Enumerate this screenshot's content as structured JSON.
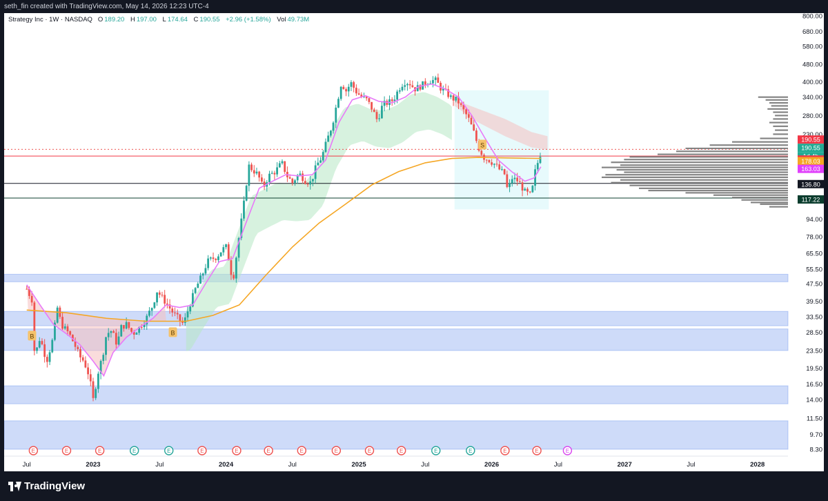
{
  "header": {
    "attribution": "seth_fin created with TradingView.com, May 14, 2026 12:23 UTC-4"
  },
  "legend": {
    "symbol": "Strategy Inc · 1W · NASDAQ",
    "open_label": "O",
    "open": "189.20",
    "high_label": "H",
    "high": "197.00",
    "low_label": "L",
    "low": "174.64",
    "close_label": "C",
    "close": "190.55",
    "change": "+2.96 (+1.58%)",
    "vol_label": "Vol",
    "vol": "49.73M"
  },
  "footer": {
    "brand": "TradingView"
  },
  "colors": {
    "up": "#26a69a",
    "down": "#ef5350",
    "ma_orange": "#f5a623",
    "ma_pink": "#e879f9",
    "zone": "#4f7fe8",
    "cloud_green": "#b6e8c5",
    "cloud_red": "#f5c0c0"
  },
  "chart_data": {
    "type": "candlestick",
    "symbol": "Strategy Inc",
    "interval": "1W",
    "exchange": "NASDAQ",
    "scale": "log",
    "ylim": [
      8.3,
      800
    ],
    "y_ticks": [
      "800.00",
      "680.00",
      "580.00",
      "480.00",
      "400.00",
      "340.00",
      "280.00",
      "230.00",
      "94.00",
      "78.00",
      "65.50",
      "55.50",
      "47.50",
      "39.50",
      "33.50",
      "28.50",
      "23.50",
      "19.50",
      "16.50",
      "14.00",
      "11.50",
      "9.70",
      "8.30"
    ],
    "x_ticks": [
      "Jul",
      "2023",
      "Jul",
      "2024",
      "Jul",
      "2025",
      "Jul",
      "2026",
      "Jul",
      "2027",
      "Jul",
      "2028"
    ],
    "price_labels": [
      {
        "value": 190.55,
        "text": "190.55",
        "color": "#f23645"
      },
      {
        "value": 190.55,
        "text": "190.55",
        "color": "#22ab94"
      },
      {
        "value": 190.55,
        "text": "1d 4h",
        "color": "#22ab94"
      },
      {
        "value": 182.47,
        "text": "182.47",
        "color": "#f23645"
      },
      {
        "value": 178.03,
        "text": "178.03",
        "color": "#f5a623"
      },
      {
        "value": 163.03,
        "text": "163.03",
        "color": "#e040fb"
      },
      {
        "value": 136.8,
        "text": "136.80",
        "color": "#131722"
      },
      {
        "value": 117.22,
        "text": "117.22",
        "color": "#0b3d2e"
      }
    ],
    "horizontal_lines": [
      {
        "value": 182.47,
        "color": "#f23645"
      },
      {
        "value": 136.8,
        "color": "#131722"
      },
      {
        "value": 117.22,
        "color": "#0b3d2e"
      }
    ],
    "zones": [
      {
        "low": 48.5,
        "high": 52.5
      },
      {
        "low": 30.5,
        "high": 35.5
      },
      {
        "low": 23.5,
        "high": 29.5
      },
      {
        "low": 13.4,
        "high": 16.2
      },
      {
        "low": 8.3,
        "high": 11.2
      }
    ],
    "signals": [
      {
        "text": "B",
        "x": 2022.54,
        "y": 27.5
      },
      {
        "text": "B",
        "x": 2023.6,
        "y": 28.5
      },
      {
        "text": "S",
        "x": 2025.93,
        "y": 206
      }
    ],
    "earnings_markers": [
      {
        "text": "E",
        "x": 2022.55,
        "type": "red"
      },
      {
        "text": "E",
        "x": 2022.8,
        "type": "red"
      },
      {
        "text": "E",
        "x": 2023.05,
        "type": "red"
      },
      {
        "text": "E",
        "x": 2023.31,
        "type": "green"
      },
      {
        "text": "E",
        "x": 2023.57,
        "type": "green"
      },
      {
        "text": "E",
        "x": 2023.82,
        "type": "red"
      },
      {
        "text": "E",
        "x": 2024.08,
        "type": "red"
      },
      {
        "text": "E",
        "x": 2024.32,
        "type": "red"
      },
      {
        "text": "E",
        "x": 2024.57,
        "type": "red"
      },
      {
        "text": "E",
        "x": 2024.83,
        "type": "red"
      },
      {
        "text": "E",
        "x": 2025.08,
        "type": "red"
      },
      {
        "text": "E",
        "x": 2025.32,
        "type": "red"
      },
      {
        "text": "E",
        "x": 2025.58,
        "type": "green"
      },
      {
        "text": "E",
        "x": 2025.84,
        "type": "green"
      },
      {
        "text": "E",
        "x": 2026.1,
        "type": "red"
      },
      {
        "text": "E",
        "x": 2026.34,
        "type": "red"
      },
      {
        "text": "E",
        "x": 2026.57,
        "type": "purple"
      }
    ],
    "price_path": [
      [
        2022.5,
        45
      ],
      [
        2022.54,
        40
      ],
      [
        2022.56,
        22
      ],
      [
        2022.6,
        27
      ],
      [
        2022.65,
        21
      ],
      [
        2022.7,
        27
      ],
      [
        2022.73,
        37
      ],
      [
        2022.76,
        31
      ],
      [
        2022.82,
        28
      ],
      [
        2022.86,
        25
      ],
      [
        2022.9,
        22
      ],
      [
        2022.93,
        21
      ],
      [
        2022.97,
        18
      ],
      [
        2023.0,
        14
      ],
      [
        2023.04,
        19
      ],
      [
        2023.07,
        22
      ],
      [
        2023.1,
        28
      ],
      [
        2023.14,
        29
      ],
      [
        2023.18,
        25
      ],
      [
        2023.21,
        30
      ],
      [
        2023.25,
        31
      ],
      [
        2023.3,
        28
      ],
      [
        2023.35,
        30
      ],
      [
        2023.4,
        33
      ],
      [
        2023.45,
        38
      ],
      [
        2023.48,
        44
      ],
      [
        2023.52,
        41
      ],
      [
        2023.56,
        38
      ],
      [
        2023.6,
        35
      ],
      [
        2023.64,
        33
      ],
      [
        2023.68,
        31
      ],
      [
        2023.72,
        37
      ],
      [
        2023.77,
        45
      ],
      [
        2023.82,
        52
      ],
      [
        2023.86,
        60
      ],
      [
        2023.9,
        62
      ],
      [
        2023.93,
        63
      ],
      [
        2023.97,
        68
      ],
      [
        2024.0,
        70
      ],
      [
        2024.03,
        58
      ],
      [
        2024.05,
        48
      ],
      [
        2024.1,
        80
      ],
      [
        2024.13,
        105
      ],
      [
        2024.17,
        165
      ],
      [
        2024.2,
        158
      ],
      [
        2024.24,
        150
      ],
      [
        2024.28,
        130
      ],
      [
        2024.32,
        148
      ],
      [
        2024.37,
        155
      ],
      [
        2024.42,
        170
      ],
      [
        2024.46,
        148
      ],
      [
        2024.5,
        138
      ],
      [
        2024.55,
        152
      ],
      [
        2024.6,
        140
      ],
      [
        2024.64,
        138
      ],
      [
        2024.68,
        165
      ],
      [
        2024.72,
        180
      ],
      [
        2024.76,
        215
      ],
      [
        2024.8,
        255
      ],
      [
        2024.84,
        330
      ],
      [
        2024.87,
        400
      ],
      [
        2024.9,
        360
      ],
      [
        2024.94,
        395
      ],
      [
        2024.98,
        360
      ],
      [
        2025.02,
        340
      ],
      [
        2025.06,
        330
      ],
      [
        2025.1,
        300
      ],
      [
        2025.14,
        265
      ],
      [
        2025.18,
        315
      ],
      [
        2025.22,
        320
      ],
      [
        2025.26,
        330
      ],
      [
        2025.3,
        370
      ],
      [
        2025.34,
        400
      ],
      [
        2025.38,
        395
      ],
      [
        2025.42,
        370
      ],
      [
        2025.46,
        380
      ],
      [
        2025.5,
        395
      ],
      [
        2025.54,
        405
      ],
      [
        2025.58,
        405
      ],
      [
        2025.62,
        370
      ],
      [
        2025.66,
        355
      ],
      [
        2025.7,
        335
      ],
      [
        2025.74,
        330
      ],
      [
        2025.78,
        300
      ],
      [
        2025.82,
        275
      ],
      [
        2025.86,
        240
      ],
      [
        2025.9,
        200
      ],
      [
        2025.94,
        180
      ],
      [
        2025.98,
        175
      ],
      [
        2026.02,
        168
      ],
      [
        2026.06,
        158
      ],
      [
        2026.1,
        150
      ],
      [
        2026.12,
        125
      ],
      [
        2026.15,
        145
      ],
      [
        2026.2,
        140
      ],
      [
        2026.25,
        125
      ],
      [
        2026.3,
        120
      ],
      [
        2026.32,
        150
      ],
      [
        2026.34,
        165
      ],
      [
        2026.37,
        190.55
      ]
    ],
    "moving_average_orange": [
      [
        2022.5,
        36
      ],
      [
        2022.8,
        35
      ],
      [
        2023.1,
        33
      ],
      [
        2023.4,
        32
      ],
      [
        2023.7,
        32
      ],
      [
        2023.9,
        34
      ],
      [
        2024.1,
        38
      ],
      [
        2024.3,
        52
      ],
      [
        2024.5,
        70
      ],
      [
        2024.7,
        90
      ],
      [
        2024.9,
        110
      ],
      [
        2025.1,
        135
      ],
      [
        2025.3,
        155
      ],
      [
        2025.5,
        170
      ],
      [
        2025.7,
        178
      ],
      [
        2025.9,
        180
      ],
      [
        2026.1,
        179
      ],
      [
        2026.37,
        178.03
      ]
    ],
    "moving_average_pink": [
      [
        2022.5,
        47
      ],
      [
        2022.6,
        38
      ],
      [
        2022.7,
        31
      ],
      [
        2022.8,
        28
      ],
      [
        2022.9,
        25
      ],
      [
        2023.0,
        21
      ],
      [
        2023.08,
        18
      ],
      [
        2023.15,
        23
      ],
      [
        2023.25,
        27
      ],
      [
        2023.35,
        30
      ],
      [
        2023.45,
        33
      ],
      [
        2023.55,
        38
      ],
      [
        2023.65,
        37
      ],
      [
        2023.75,
        38
      ],
      [
        2023.85,
        48
      ],
      [
        2023.95,
        60
      ],
      [
        2024.05,
        62
      ],
      [
        2024.15,
        90
      ],
      [
        2024.25,
        130
      ],
      [
        2024.35,
        140
      ],
      [
        2024.45,
        150
      ],
      [
        2024.55,
        148
      ],
      [
        2024.65,
        150
      ],
      [
        2024.75,
        175
      ],
      [
        2024.85,
        260
      ],
      [
        2024.95,
        330
      ],
      [
        2025.05,
        345
      ],
      [
        2025.15,
        325
      ],
      [
        2025.25,
        320
      ],
      [
        2025.35,
        340
      ],
      [
        2025.45,
        380
      ],
      [
        2025.55,
        390
      ],
      [
        2025.65,
        370
      ],
      [
        2025.75,
        340
      ],
      [
        2025.85,
        280
      ],
      [
        2025.95,
        220
      ],
      [
        2026.05,
        175
      ],
      [
        2026.15,
        155
      ],
      [
        2026.25,
        140
      ],
      [
        2026.32,
        145
      ],
      [
        2026.37,
        163.03
      ]
    ],
    "volume_profile": [
      [
        340,
        0.16
      ],
      [
        330,
        0.12
      ],
      [
        320,
        0.1
      ],
      [
        310,
        0.09
      ],
      [
        300,
        0.11
      ],
      [
        290,
        0.08
      ],
      [
        280,
        0.07
      ],
      [
        270,
        0.08
      ],
      [
        260,
        0.1
      ],
      [
        250,
        0.08
      ],
      [
        240,
        0.07
      ],
      [
        230,
        0.08
      ],
      [
        220,
        0.15
      ],
      [
        212,
        0.3
      ],
      [
        205,
        0.42
      ],
      [
        198,
        0.55
      ],
      [
        192,
        0.6
      ],
      [
        186,
        0.7
      ],
      [
        181,
        0.85
      ],
      [
        176,
        0.88
      ],
      [
        171,
        0.95
      ],
      [
        166,
        0.9
      ],
      [
        162,
        1.0
      ],
      [
        158,
        0.92
      ],
      [
        154,
        0.88
      ],
      [
        150,
        0.98
      ],
      [
        146,
        1.0
      ],
      [
        142,
        0.9
      ],
      [
        138,
        0.95
      ],
      [
        134,
        0.85
      ],
      [
        130,
        0.8
      ],
      [
        127,
        0.75
      ],
      [
        124,
        0.55
      ],
      [
        121,
        0.4
      ],
      [
        118,
        0.3
      ],
      [
        115,
        0.25
      ],
      [
        112,
        0.2
      ],
      [
        110,
        0.15
      ],
      [
        107,
        0.1
      ]
    ]
  }
}
